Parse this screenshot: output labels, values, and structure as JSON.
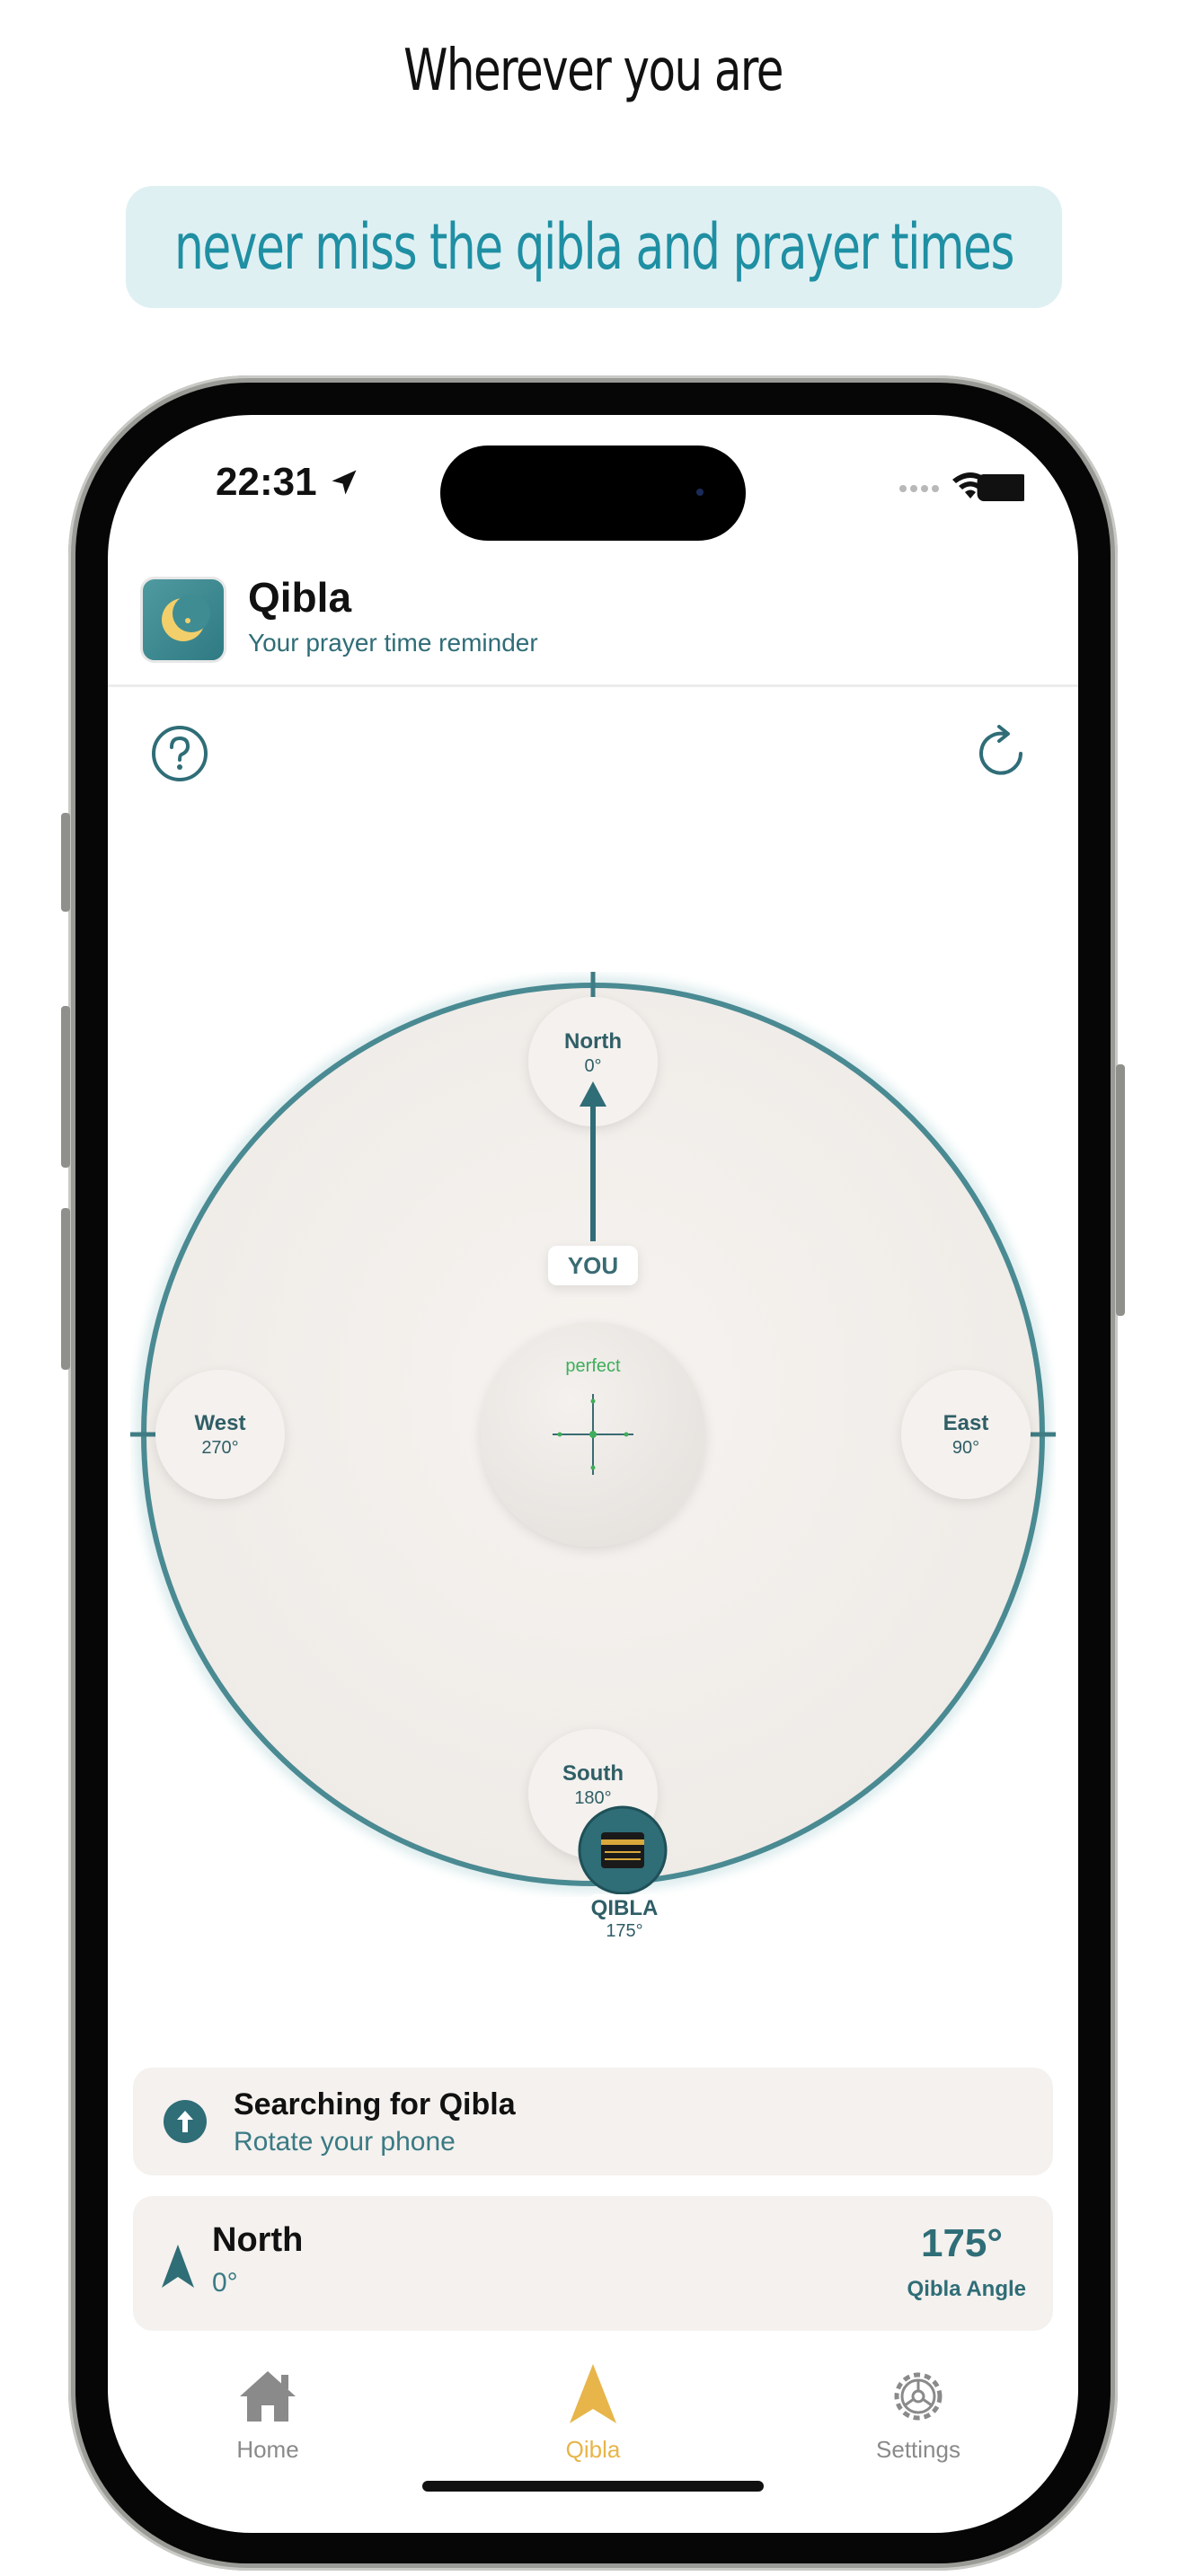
{
  "promo": {
    "headline": "Wherever you are",
    "tagline": "never miss the qibla and prayer times"
  },
  "status_bar": {
    "time": "22:31"
  },
  "header": {
    "title": "Qibla",
    "subtitle": "Your prayer time reminder"
  },
  "compass": {
    "north": {
      "name": "North",
      "deg": "0°"
    },
    "east": {
      "name": "East",
      "deg": "90°"
    },
    "south": {
      "name": "South",
      "deg": "180°"
    },
    "west": {
      "name": "West",
      "deg": "270°"
    },
    "you_label": "YOU",
    "center_status": "perfect",
    "qibla_label": "QIBLA",
    "qibla_deg": "175°"
  },
  "status_card": {
    "title": "Searching for Qibla",
    "subtitle": "Rotate your phone"
  },
  "heading_card": {
    "direction": "North",
    "degrees": "0°",
    "qibla_angle": "175°",
    "qibla_angle_label": "Qibla Angle"
  },
  "tabs": [
    {
      "label": "Home",
      "icon": "house-icon",
      "active": false
    },
    {
      "label": "Qibla",
      "icon": "qibla-arrow-icon",
      "active": true
    },
    {
      "label": "Settings",
      "icon": "gear-icon",
      "active": false
    }
  ],
  "colors": {
    "accent": "#2f7a83",
    "teal_text": "#1f8fa3",
    "active_tab": "#e7b54a",
    "inactive_tab": "#8a8a8a",
    "perfect_green": "#3fae5a",
    "card_bg": "#f4f1ee"
  }
}
